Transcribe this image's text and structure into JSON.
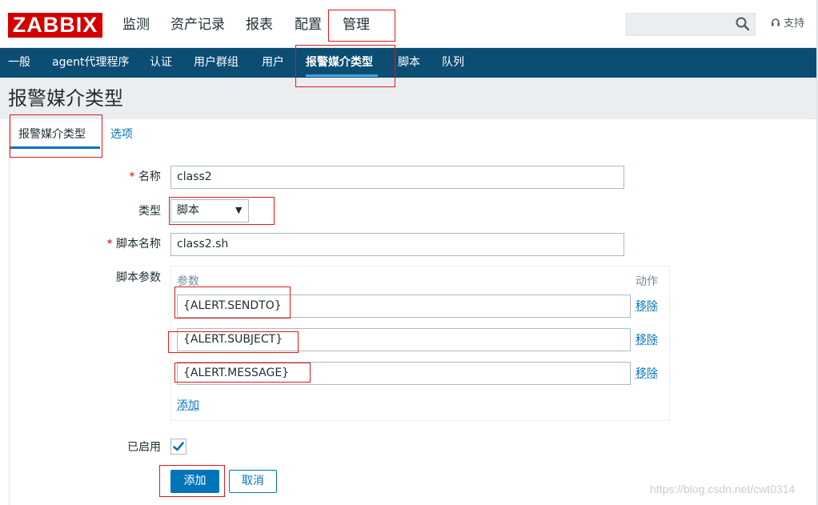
{
  "header": {
    "logo": "ZABBIX",
    "nav": [
      "监测",
      "资产记录",
      "报表",
      "配置",
      "管理"
    ],
    "support": "支持"
  },
  "subnav": {
    "items": [
      "一般",
      "agent代理程序",
      "认证",
      "用户群组",
      "用户",
      "报警媒介类型",
      "脚本",
      "队列"
    ],
    "active": "报警媒介类型"
  },
  "page": {
    "title": "报警媒介类型"
  },
  "tabs": {
    "active": "报警媒介类型",
    "other": "选项"
  },
  "form": {
    "name_label": "名称",
    "name_value": "class2",
    "type_label": "类型",
    "type_value": "脚本",
    "script_name_label": "脚本名称",
    "script_name_value": "class2.sh",
    "script_params_label": "脚本参数",
    "params_header": "参数",
    "action_header": "动作",
    "params": [
      {
        "value": "{ALERT.SENDTO}",
        "remove": "移除"
      },
      {
        "value": "{ALERT.SUBJECT}",
        "remove": "移除"
      },
      {
        "value": "{ALERT.MESSAGE}",
        "remove": "移除"
      }
    ],
    "add_param": "添加",
    "enabled_label": "已启用",
    "enabled": true,
    "submit": "添加",
    "cancel": "取消"
  },
  "watermark": "https://blog.csdn.net/cwt0314",
  "colors": {
    "brand": "#d40000",
    "subnav": "#0b4d73",
    "accent": "#0275b8",
    "highlight_box": "#e0181b"
  }
}
